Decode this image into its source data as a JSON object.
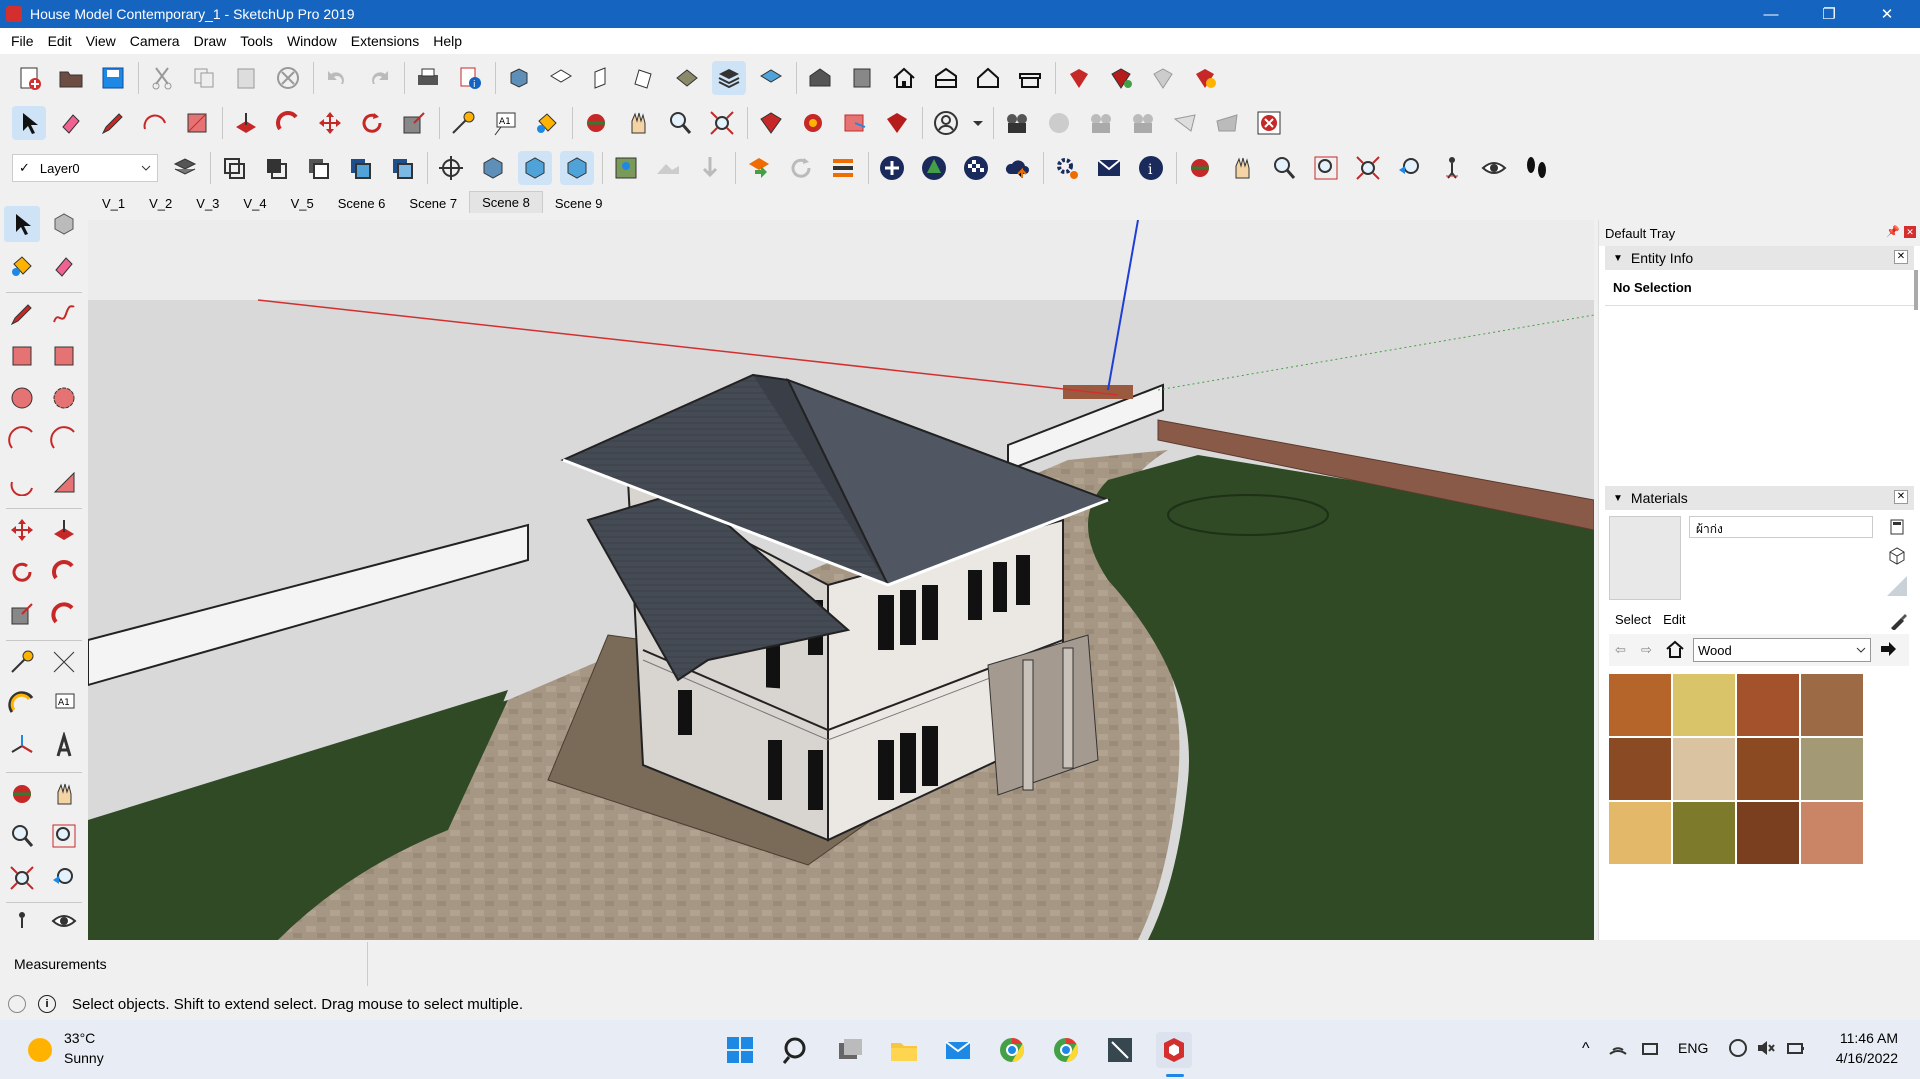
{
  "window": {
    "title": "House Model Contemporary_1 - SketchUp Pro 2019",
    "minimize": "—",
    "restore": "❐",
    "close": "✕"
  },
  "menu": [
    "File",
    "Edit",
    "View",
    "Camera",
    "Draw",
    "Tools",
    "Window",
    "Extensions",
    "Help"
  ],
  "layer_toolbar": {
    "check": "✓",
    "layer": "Layer0"
  },
  "scene_tabs": [
    "V_1",
    "V_2",
    "V_3",
    "V_4",
    "V_5",
    "Scene 6",
    "Scene 7",
    "Scene 8",
    "Scene 9"
  ],
  "tray": {
    "title": "Default Tray",
    "entity_info": {
      "title": "Entity Info",
      "selection": "No Selection"
    },
    "materials": {
      "title": "Materials",
      "current_name": "ผ้าก่ง",
      "tabs": [
        "Select",
        "Edit"
      ],
      "collection": "Wood",
      "swatch_colors": [
        "#b5642a",
        "#d9c46a",
        "#a3522c",
        "#9c6a45",
        "#8a4a24",
        "#d9c3a1",
        "#8b4a22",
        "#a39a75",
        "#e3b868",
        "#7d7a2c",
        "#7a3f1f",
        "#c98565"
      ]
    }
  },
  "measurements": {
    "label": "Measurements"
  },
  "status": {
    "text": "Select objects. Shift to extend select. Drag mouse to select multiple."
  },
  "taskbar": {
    "weather": {
      "temp": "33°C",
      "desc": "Sunny"
    },
    "lang": "ENG",
    "time": "11:46 AM",
    "date": "4/16/2022"
  }
}
